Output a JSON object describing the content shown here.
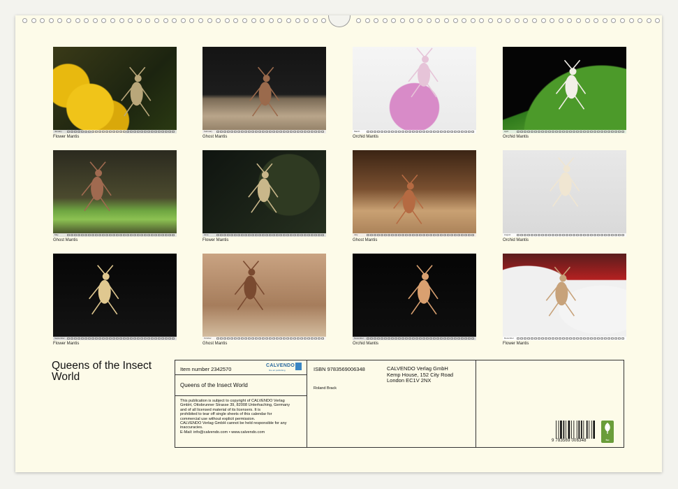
{
  "calendar": {
    "title": "Queens of the Insect World",
    "photos": [
      {
        "caption": "Flower Mantis",
        "month": "January"
      },
      {
        "caption": "Ghost Mantis",
        "month": "February"
      },
      {
        "caption": "Orchid Mantis",
        "month": "March"
      },
      {
        "caption": "Orchid Mantis",
        "month": "April"
      },
      {
        "caption": "Ghost Mantis",
        "month": "May"
      },
      {
        "caption": "Flower Mantis",
        "month": "June"
      },
      {
        "caption": "Ghost Mantis",
        "month": "July"
      },
      {
        "caption": "Orchid Mantis",
        "month": "August"
      },
      {
        "caption": "Flower Mantis",
        "month": "September"
      },
      {
        "caption": "Ghost Mantis",
        "month": "October"
      },
      {
        "caption": "Orchid Mantis",
        "month": "November"
      },
      {
        "caption": "Flower Mantis",
        "month": "December"
      }
    ]
  },
  "info": {
    "item_number": "Item number 2342570",
    "logo": "CALVENDO",
    "logo_tagline": "fine art publishing",
    "product_title": "Queens of the Insect World",
    "legal_text": [
      "This publication is subject to copyright of CALVENDO Verlag",
      "GmbH, Ottobrunner Strasse 39, 82008 Unterhaching, Germany",
      "and of all licensed material of its licensers. It is",
      "prohibited to tear off single sheets of this calendar for",
      "commercial use without explicit permission.",
      "CALVENDO Verlag GmbH cannot be held responsible for any",
      "inaccuracies.",
      "E-Mail: info@calvendo.com • www.calvendo.com"
    ],
    "isbn": "ISBN 9783569006348",
    "author": "Roland Brack",
    "publisher_lines": [
      "CALVENDO Verlag GmbH",
      "Kemp House, 152 City Road",
      "London EC1V 2NX"
    ],
    "barcode_number": "9 783569 006348",
    "fsc_label": "fsc"
  }
}
